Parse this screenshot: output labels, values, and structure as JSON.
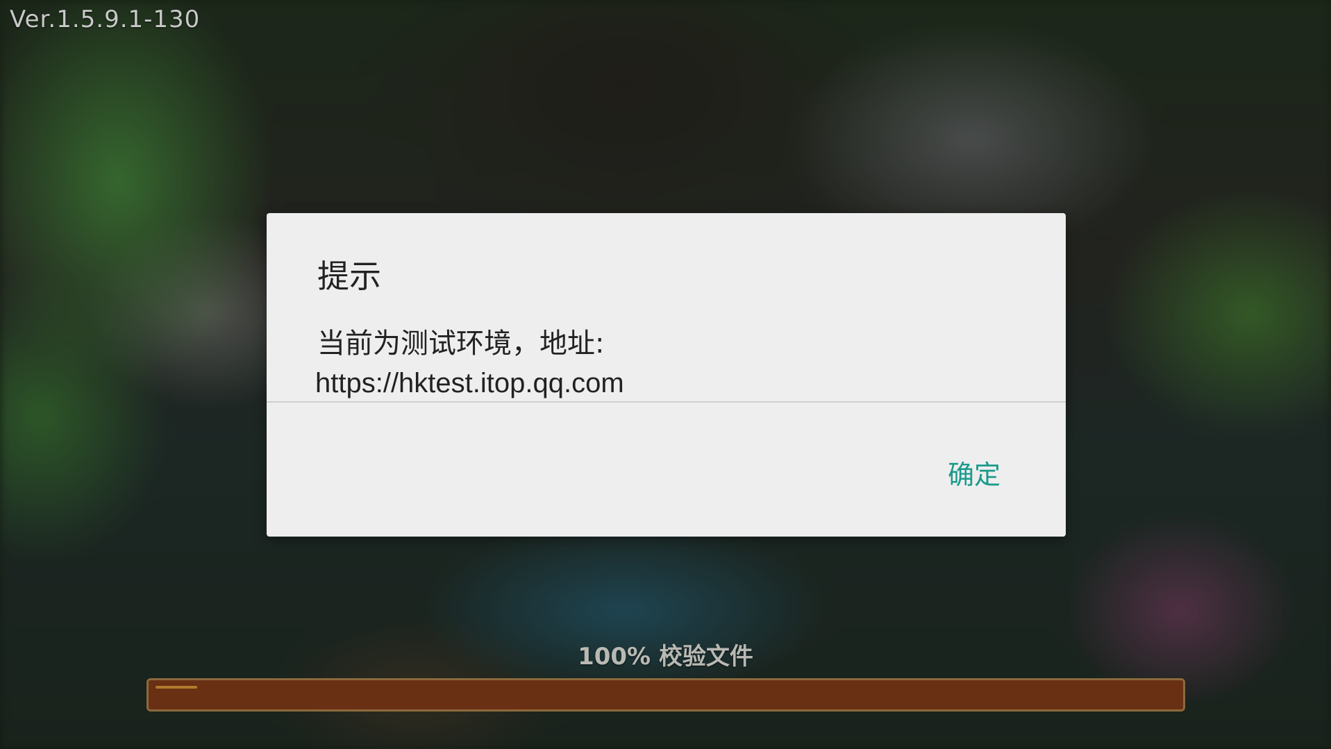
{
  "version": "Ver.1.5.9.1-130",
  "dialog": {
    "title": "提示",
    "message_line1": "当前为测试环境，地址:",
    "message_line2": "https://hktest.itop.qq.com",
    "confirm_label": "确定"
  },
  "loading": {
    "label": "100% 校验文件",
    "progress": 1.0
  },
  "colors": {
    "dialog_background": "#eeeeee",
    "button_accent": "#1a9a8c",
    "progress_fill": "#6a3014",
    "progress_border": "#8c6a3c"
  }
}
